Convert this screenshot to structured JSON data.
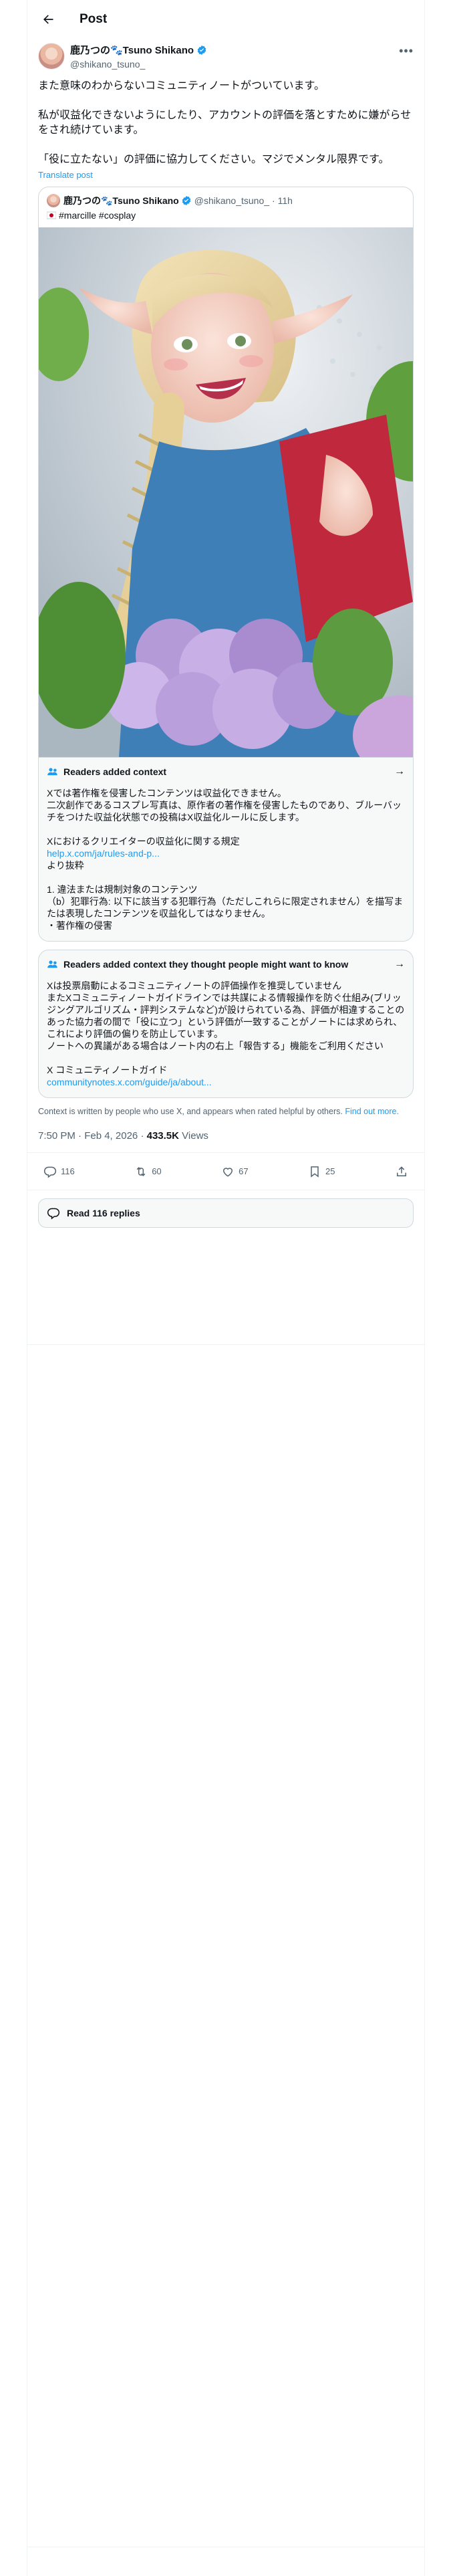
{
  "header": {
    "title": "Post"
  },
  "author": {
    "name": "鹿乃つの🐾Tsuno Shikano",
    "handle": "@shikano_tsuno_"
  },
  "post": {
    "paragraphs": [
      "また意味のわからないコミュニティノートがついています。",
      "私が収益化できないようにしたり、アカウントの評価を落とすために嫌がらせをされ続けています。",
      "「役に立たない」の評価に協力してください。マジでメンタル限界です。"
    ],
    "translate_label": "Translate post"
  },
  "quote": {
    "name": "鹿乃つの🐾Tsuno Shikano",
    "handle": "@shikano_tsuno_",
    "time": "· 11h",
    "text": "#marcille #cosplay"
  },
  "note1": {
    "title": "Readers added context",
    "lines": [
      "Xでは著作権を侵害したコンテンツは収益化できません。",
      "二次創作であるコスプレ写真は、原作者の著作権を侵害したものであり、ブルーバッチをつけた収益化状態での投稿はX収益化ルールに反します。"
    ],
    "lines2": [
      "Xにおけるクリエイターの収益化に関する規定"
    ],
    "link": "help.x.com/ja/rules-and-p...",
    "lines3": [
      "より抜粋"
    ],
    "lines4": [
      "1. 違法または規制対象のコンテンツ",
      "（b）犯罪行為: 以下に該当する犯罪行為（ただしこれらに限定されません）を描写または表現したコンテンツを収益化してはなりません。",
      "・著作権の侵害"
    ]
  },
  "note2": {
    "title": "Readers added context they thought people might want to know",
    "lines": [
      "Xは投票扇動によるコミュニティノートの評価操作を推奨していません",
      "またXコミュニティノートガイドラインでは共謀による情報操作を防ぐ仕組み(ブリッジングアルゴリズム・評判システムなど)が設けられている為、評価が相違することのあった協力者の間で「役に立つ」という評価が一致することがノートには求められ、これにより評価の偏りを防止しています。",
      "ノートへの異議がある場合はノート内の右上「報告する」機能をご利用ください"
    ],
    "lines2": [
      "X コミュニティノートガイド"
    ],
    "link": "communitynotes.x.com/guide/ja/about..."
  },
  "context_footer": {
    "text": "Context is written by people who use X, and appears when rated helpful by others.",
    "link": "Find out more."
  },
  "meta": {
    "time": "7:50 PM · Feb 4, 2026",
    "sep": "·",
    "views_count": "433.5K",
    "views_label": "Views"
  },
  "actions": {
    "replies": "116",
    "reposts": "60",
    "likes": "67",
    "bookmarks": "25"
  },
  "read_replies": {
    "label": "Read 116 replies"
  },
  "colors": {
    "accent": "#1d9bf0",
    "verified": "#1d9bf0",
    "text": "#0f1419",
    "muted": "#536471",
    "border": "#cfd9de"
  },
  "icons": [
    "back-arrow-icon",
    "verified-badge-icon",
    "more-icon",
    "people-icon",
    "arrow-right-icon",
    "reply-icon",
    "repost-icon",
    "like-icon",
    "bookmark-icon",
    "share-icon",
    "speech-bubble-icon",
    "japan-flag-icon"
  ]
}
